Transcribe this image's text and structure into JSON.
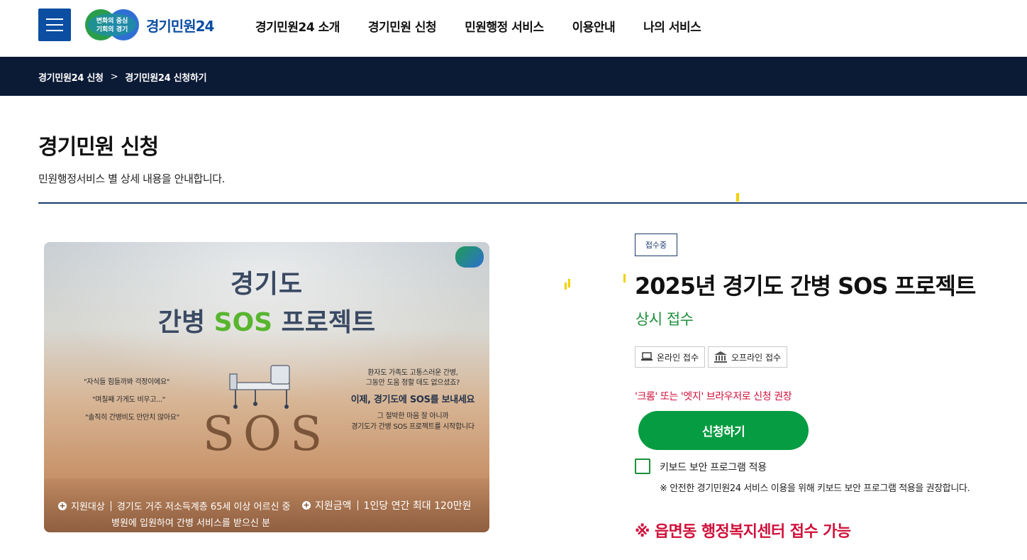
{
  "header": {
    "logo_badge_line1": "변화의 중심",
    "logo_badge_line2": "기회의 경기",
    "logo_text": "경기민원24",
    "nav": [
      {
        "label": "경기민원24 소개"
      },
      {
        "label": "경기민원 신청"
      },
      {
        "label": "민원행정 서비스"
      },
      {
        "label": "이용안내"
      },
      {
        "label": "나의 서비스"
      }
    ]
  },
  "breadcrumb": {
    "items": [
      {
        "label": "경기민원24 신청"
      },
      {
        "label": "경기민원24 신청하기"
      }
    ],
    "separator": ">"
  },
  "page": {
    "title": "경기민원 신청",
    "description": "민원행정서비스 별 상세 내용을 안내합니다."
  },
  "poster": {
    "title_line1": "경기도",
    "title_line2_pre": "간병 ",
    "title_line2_highlight": "SOS",
    "title_line2_post": " 프로젝트",
    "quotes": [
      "\"자식들 힘들까봐 걱정이에요\"",
      "\"며칠째 가게도 비우고...\"",
      "\"솔직히 간병비도 만만치 않아요\""
    ],
    "right_copy_1": "환자도 가족도 고통스러운 간병,",
    "right_copy_2": "그동안 도움 청할 데도 없으셨죠?",
    "right_copy_3": "이제, 경기도에 SOS를 보내세요",
    "right_copy_4": "그 절박한 마음 잘 아니까",
    "right_copy_5": "경기도가 간병 SOS 프로젝트를 시작합니다",
    "sand_text": "SOS",
    "target_label": "지원대상",
    "target_line1": "경기도 거주 저소득계층 65세 이상 어르신 중",
    "target_line2": "병원에 입원하여 간병 서비스를 받으신 분",
    "amount_label": "지원금액",
    "amount_value": "1인당 연간 최대 120만원"
  },
  "service": {
    "status_badge": "접수중",
    "title": "2025년 경기도 간병 SOS 프로젝트",
    "receipt_type": "상시 접수",
    "tags": [
      {
        "label": "온라인 접수",
        "icon": "laptop-icon"
      },
      {
        "label": "오프라인 접수",
        "icon": "building-icon"
      }
    ],
    "browser_note": "'크롬' 또는 '엣지' 브라우저로 신청 권장",
    "apply_label": "신청하기",
    "keyboard_security_label": "키보드 보안 프로그램 적용",
    "keyboard_security_note": "※ 안전한 경기민원24 서비스 이용을 위해 키보드 보안 프로그램 적용을 권장합니다.",
    "center_note": "※ 읍면동 행정복지센터 접수 가능"
  },
  "colors": {
    "brand_blue": "#0b4ea2",
    "nav_dark": "#0b1a35",
    "green": "#069c42",
    "alert_red": "#d0103a"
  }
}
